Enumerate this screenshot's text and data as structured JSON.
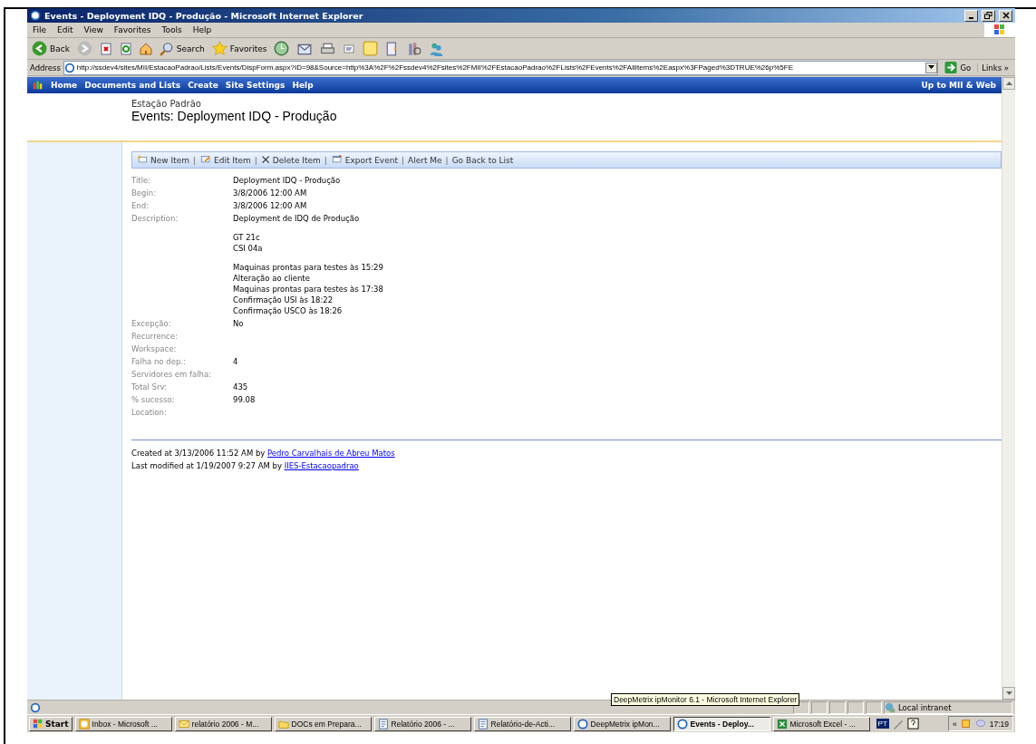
{
  "window": {
    "title": "Events - Deployment IDQ - Produção - Microsoft Internet Explorer"
  },
  "menu": [
    "File",
    "Edit",
    "View",
    "Favorites",
    "Tools",
    "Help"
  ],
  "toolbar": [
    {
      "kind": "back",
      "label": "Back"
    },
    {
      "kind": "forward"
    },
    {
      "kind": "stop"
    },
    {
      "kind": "refresh"
    },
    {
      "kind": "home"
    },
    {
      "kind": "search",
      "label": "Search"
    },
    {
      "kind": "favorites",
      "label": "Favorites"
    },
    {
      "kind": "history"
    },
    {
      "kind": "mail"
    },
    {
      "kind": "print"
    },
    {
      "kind": "edit"
    },
    {
      "kind": "note"
    },
    {
      "kind": "research"
    },
    {
      "kind": "tool"
    },
    {
      "kind": "messenger"
    }
  ],
  "address": {
    "label": "Address",
    "value": "http://ssdev4/sites/MII/EstacaoPadrao/Lists/Events/DispForm.aspx?ID=98&Source=http%3A%2F%2Fssdev4%2Fsites%2FMII%2FEstacaoPadrao%2FLists%2FEvents%2FAllItems%2Easpx%3FPaged%3DTRUE%26p%5FE",
    "go": "Go",
    "links": "Links",
    "more": "»"
  },
  "nav": {
    "items": [
      "Home",
      "Documents and Lists",
      "Create",
      "Site Settings",
      "Help"
    ],
    "up_link": "Up to MII & Web"
  },
  "site": {
    "name": "Estação Padrão",
    "page_title": "Events: Deployment IDQ - Produção"
  },
  "action_separator": "|",
  "actions": [
    {
      "kind": "new",
      "label": "New Item"
    },
    {
      "kind": "edit",
      "label": "Edit Item"
    },
    {
      "kind": "delete",
      "label": "Delete Item"
    },
    {
      "kind": "export",
      "label": "Export Event"
    },
    {
      "kind": "text",
      "label": "Alert Me"
    },
    {
      "kind": "text",
      "label": "Go Back to List"
    }
  ],
  "fields": [
    {
      "label": "Title:",
      "value": "Deployment IDQ - Produção"
    },
    {
      "label": "Begin:",
      "value": "3/8/2006 12:00 AM"
    },
    {
      "label": "End:",
      "value": "3/8/2006 12:00 AM"
    },
    {
      "label": "Description:",
      "paragraphs": [
        [
          "Deployment de IDQ de Produção"
        ],
        [
          "GT 21c",
          "CSI 04a"
        ],
        [
          "Maquinas prontas para testes às 15:29",
          "Alteração ao cliente",
          "Maquinas prontas para testes às 17:38",
          "Confirmação USI às 18:22",
          "Confirmação USCO às 18:26"
        ]
      ]
    },
    {
      "label": "Excepção:",
      "value": "No"
    },
    {
      "label": "Recurrence:"
    },
    {
      "label": "Workspace:"
    },
    {
      "label": "Falha no dep.:",
      "value": "4"
    },
    {
      "label": "Servidores em falha:"
    },
    {
      "label": "Total Srv:",
      "value": "435"
    },
    {
      "label": "% sucesso:",
      "value": "99.08"
    },
    {
      "label": "Location:"
    }
  ],
  "footer": [
    {
      "text": "Created at 3/13/2006 11:52 AM by ",
      "link": "Pedro Carvalhais de Abreu Matos"
    },
    {
      "text": "Last modified at 1/19/2007 9:27 AM by ",
      "link": "IIES-Estacaopadrao"
    }
  ],
  "tooltip": "DeepMetrix ipMonitor 6.1 - Microsoft Internet Explorer",
  "status": {
    "zone": "Local intranet"
  },
  "taskbar": {
    "start": "Start",
    "tasks": [
      {
        "kind": "clock",
        "label": "Inbox - Microsoft ...",
        "selected": false
      },
      {
        "kind": "mail",
        "label": "relatório 2006 - M...",
        "selected": false
      },
      {
        "kind": "folder",
        "label": "DOCs em Prepara...",
        "selected": false
      },
      {
        "kind": "word",
        "label": "Relatório 2006 - ...",
        "selected": false
      },
      {
        "kind": "word",
        "label": "Relatório-de-Acti...",
        "selected": false
      },
      {
        "kind": "ie",
        "label": "DeepMetrix ipMon...",
        "selected": false
      },
      {
        "kind": "ie",
        "label": "Events - Deploy...",
        "selected": true
      },
      {
        "kind": "excel",
        "label": "Microsoft Excel - ...",
        "selected": false
      }
    ],
    "language": "PT",
    "tray_more": "«",
    "time": "17:19"
  }
}
